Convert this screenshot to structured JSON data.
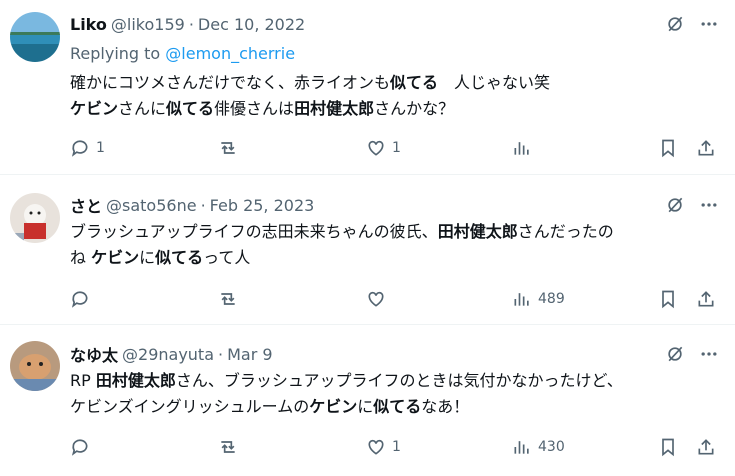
{
  "tweets": [
    {
      "name": "Liko",
      "handle": "@liko159",
      "separator": "·",
      "date": "Dec 10, 2022",
      "replying_prefix": "Replying to",
      "replying_handle": "@lemon_cherrie",
      "text_line1": [
        "確かにコツメさんだけでなく、赤ライオンも",
        "似てる",
        "　人じゃない笑"
      ],
      "text_line2": [
        "ケビン",
        "さんに",
        "似てる",
        "俳優さんは",
        "田村健太郎",
        "さんかな？"
      ],
      "counts": {
        "reply": "1",
        "retweet": "",
        "like": "1",
        "views": ""
      }
    },
    {
      "name": "さと",
      "handle": "@sato56ne",
      "separator": "·",
      "date": "Feb 25, 2023",
      "text_line1": [
        "ブラッシュアップライフの志田未来ちゃんの彼氏、",
        "田村健太郎",
        "さんだったの"
      ],
      "text_line2": [
        "ね ",
        "ケビン",
        "に",
        "似てる",
        "って人"
      ],
      "counts": {
        "reply": "",
        "retweet": "",
        "like": "",
        "views": "489"
      }
    },
    {
      "name": "なゆ太",
      "handle": "@29nayuta",
      "separator": "·",
      "date": "Mar 9",
      "text_line1": [
        "RP ",
        "田村健太郎",
        "さん、ブラッシュアップライフのときは気付かなかったけど、"
      ],
      "text_line2": [
        "ケビンズイングリッシュルームの",
        "ケビン",
        "に",
        "似てる",
        "なあ！"
      ],
      "counts": {
        "reply": "",
        "retweet": "",
        "like": "1",
        "views": "430"
      }
    }
  ],
  "colors": {
    "text": "#0f1419",
    "muted": "#536471",
    "link": "#1d9bf0",
    "divider": "#eff3f4"
  },
  "icons": [
    "grok-icon",
    "more-icon",
    "reply-icon",
    "retweet-icon",
    "like-icon",
    "views-icon",
    "bookmark-icon",
    "share-icon"
  ]
}
